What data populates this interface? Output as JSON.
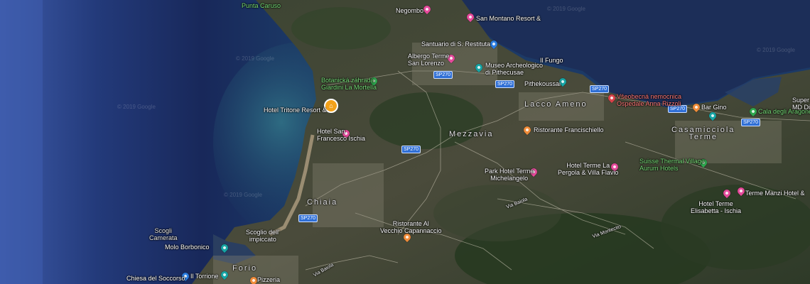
{
  "map": {
    "copyright": "© 2019 Google",
    "places": [
      {
        "id": "punta-caruso",
        "text": "Punta Caruso",
        "style": "green"
      },
      {
        "id": "negombo",
        "text": "Negombo",
        "style": ""
      },
      {
        "id": "san-montano",
        "text": "San Montano Resort &",
        "style": ""
      },
      {
        "id": "santuario",
        "text": "Santuario di S. Restituta",
        "style": ""
      },
      {
        "id": "albergo-terme",
        "text": "Albergo Terme\nSan Lorenzo",
        "style": ""
      },
      {
        "id": "museo",
        "text": "Museo Archeologico\ndi Pithecusae",
        "style": ""
      },
      {
        "id": "il-fungo",
        "text": "Il Fungo",
        "style": ""
      },
      {
        "id": "pithekoussai",
        "text": "Pithekoussai",
        "style": ""
      },
      {
        "id": "botanicka",
        "text": "Botanická záhrada\nGiardini La Mortella",
        "style": "green"
      },
      {
        "id": "hotel-tritone",
        "text": "Hotel Tritone Resort &",
        "style": ""
      },
      {
        "id": "lacco-ameno",
        "text": "Lacco Ameno",
        "style": "area"
      },
      {
        "id": "vseobecna",
        "text": "Všeobecná nemocnica\nOspedale Anna Rizzoli",
        "style": "red"
      },
      {
        "id": "bar-gino",
        "text": "Bar Gino",
        "style": ""
      },
      {
        "id": "cala",
        "text": "Cala degli Aragonesi",
        "style": ""
      },
      {
        "id": "super",
        "text": "Super\nMD Dis",
        "style": ""
      },
      {
        "id": "hotel-san",
        "text": "Hotel San\nFrancesco Ischia",
        "style": ""
      },
      {
        "id": "mezzavia",
        "text": "Mezzavia",
        "style": "area"
      },
      {
        "id": "ristorante-francischiello",
        "text": "Ristorante Francischiello",
        "style": ""
      },
      {
        "id": "casamicciola",
        "text": "Casamicciola\nTerme",
        "style": "area"
      },
      {
        "id": "suisse",
        "text": "Suisse Thermal Village\nAurum Hotels",
        "style": "green"
      },
      {
        "id": "park-hotel",
        "text": "Park Hotel Terme\nMichelangelo",
        "style": ""
      },
      {
        "id": "hotel-terme-la",
        "text": "Hotel Terme La\nPergola & Villa Flavio",
        "style": ""
      },
      {
        "id": "terme-manzi",
        "text": "Terme Manzi Hotel &",
        "style": ""
      },
      {
        "id": "hotel-terme-elisabetta",
        "text": "Hotel Terme\nElisabetta - Ischia",
        "style": ""
      },
      {
        "id": "via-baiola-1",
        "text": "Via Baiola",
        "style": "road"
      },
      {
        "id": "via-montecito",
        "text": "Via Montecito",
        "style": "road"
      },
      {
        "id": "chiaia",
        "text": "Chiaia",
        "style": "area"
      },
      {
        "id": "scogli-camerata",
        "text": "Scogli\nCamerata",
        "style": "sea"
      },
      {
        "id": "molo-borbonico",
        "text": "Molo Borbonico",
        "style": ""
      },
      {
        "id": "scoglio-impiccato",
        "text": "Scoglio dell'\nimpiccato",
        "style": ""
      },
      {
        "id": "ristorante-al-vecchio",
        "text": "Ristorante Al\nVecchio Capannaccio",
        "style": ""
      },
      {
        "id": "chiesa-soccorso",
        "text": "Chiesa del Soccorso",
        "style": ""
      },
      {
        "id": "il-torrione",
        "text": "Il Torrione",
        "style": ""
      },
      {
        "id": "forio",
        "text": "Forio",
        "style": "area"
      },
      {
        "id": "pizzeria",
        "text": "Pizzeria",
        "style": ""
      },
      {
        "id": "via-baiola-2",
        "text": "Via Baiola",
        "style": "road"
      }
    ],
    "road_shields": [
      "SP270",
      "SP270",
      "SP270",
      "SP270",
      "SP270",
      "SP270",
      "SP270",
      "SP270"
    ]
  }
}
